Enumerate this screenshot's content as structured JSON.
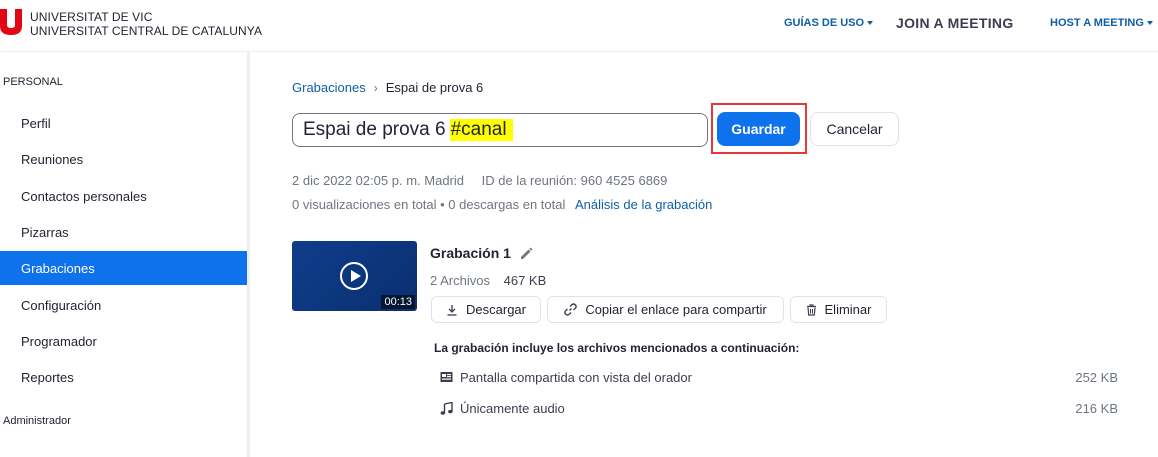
{
  "header": {
    "brand_line1": "UNIVERSITAT DE VIC",
    "brand_line2": "UNIVERSITAT CENTRAL DE CATALUNYA",
    "brand_color": "#e30613",
    "nav_guias": "GUÍAS DE USO",
    "nav_join": "JOIN A MEETING",
    "nav_host": "HOST A MEETING"
  },
  "sidebar": {
    "section_personal": "PERSONAL",
    "items": [
      {
        "label": "Perfil"
      },
      {
        "label": "Reuniones"
      },
      {
        "label": "Contactos personales"
      },
      {
        "label": "Pizarras"
      },
      {
        "label": "Grabaciones",
        "active": true
      },
      {
        "label": "Configuración"
      },
      {
        "label": "Programador"
      },
      {
        "label": "Reportes"
      }
    ],
    "section_admin": "Administrador",
    "active_color": "#0e72ed"
  },
  "breadcrumb": {
    "parent": "Grabaciones",
    "current": "Espai de prova 6"
  },
  "title_input": {
    "value_main": "Espai de prova 6",
    "value_highlight": "#canal"
  },
  "buttons": {
    "save": "Guardar",
    "cancel": "Cancelar"
  },
  "meta": {
    "date": "2 dic 2022 02:05 p. m. Madrid",
    "meeting_id": "ID de la reunión: 960 4525 6869",
    "stats": "0 visualizaciones en total • 0 descargas en total",
    "analysis_link": "Análisis de la grabación"
  },
  "recording": {
    "name": "Grabación 1",
    "duration": "00:13",
    "files_count": "2 Archivos",
    "total_size": "467 KB",
    "actions": {
      "download": "Descargar",
      "copy_link": "Copiar el enlace para compartir",
      "delete": "Eliminar"
    },
    "files_heading": "La grabación incluye los archivos mencionados a continuación:",
    "files": [
      {
        "name": "Pantalla compartida con vista del orador",
        "size": "252 KB",
        "icon": "screen-share-icon"
      },
      {
        "name": "Únicamente audio",
        "size": "216 KB",
        "icon": "music-note-icon"
      }
    ]
  }
}
